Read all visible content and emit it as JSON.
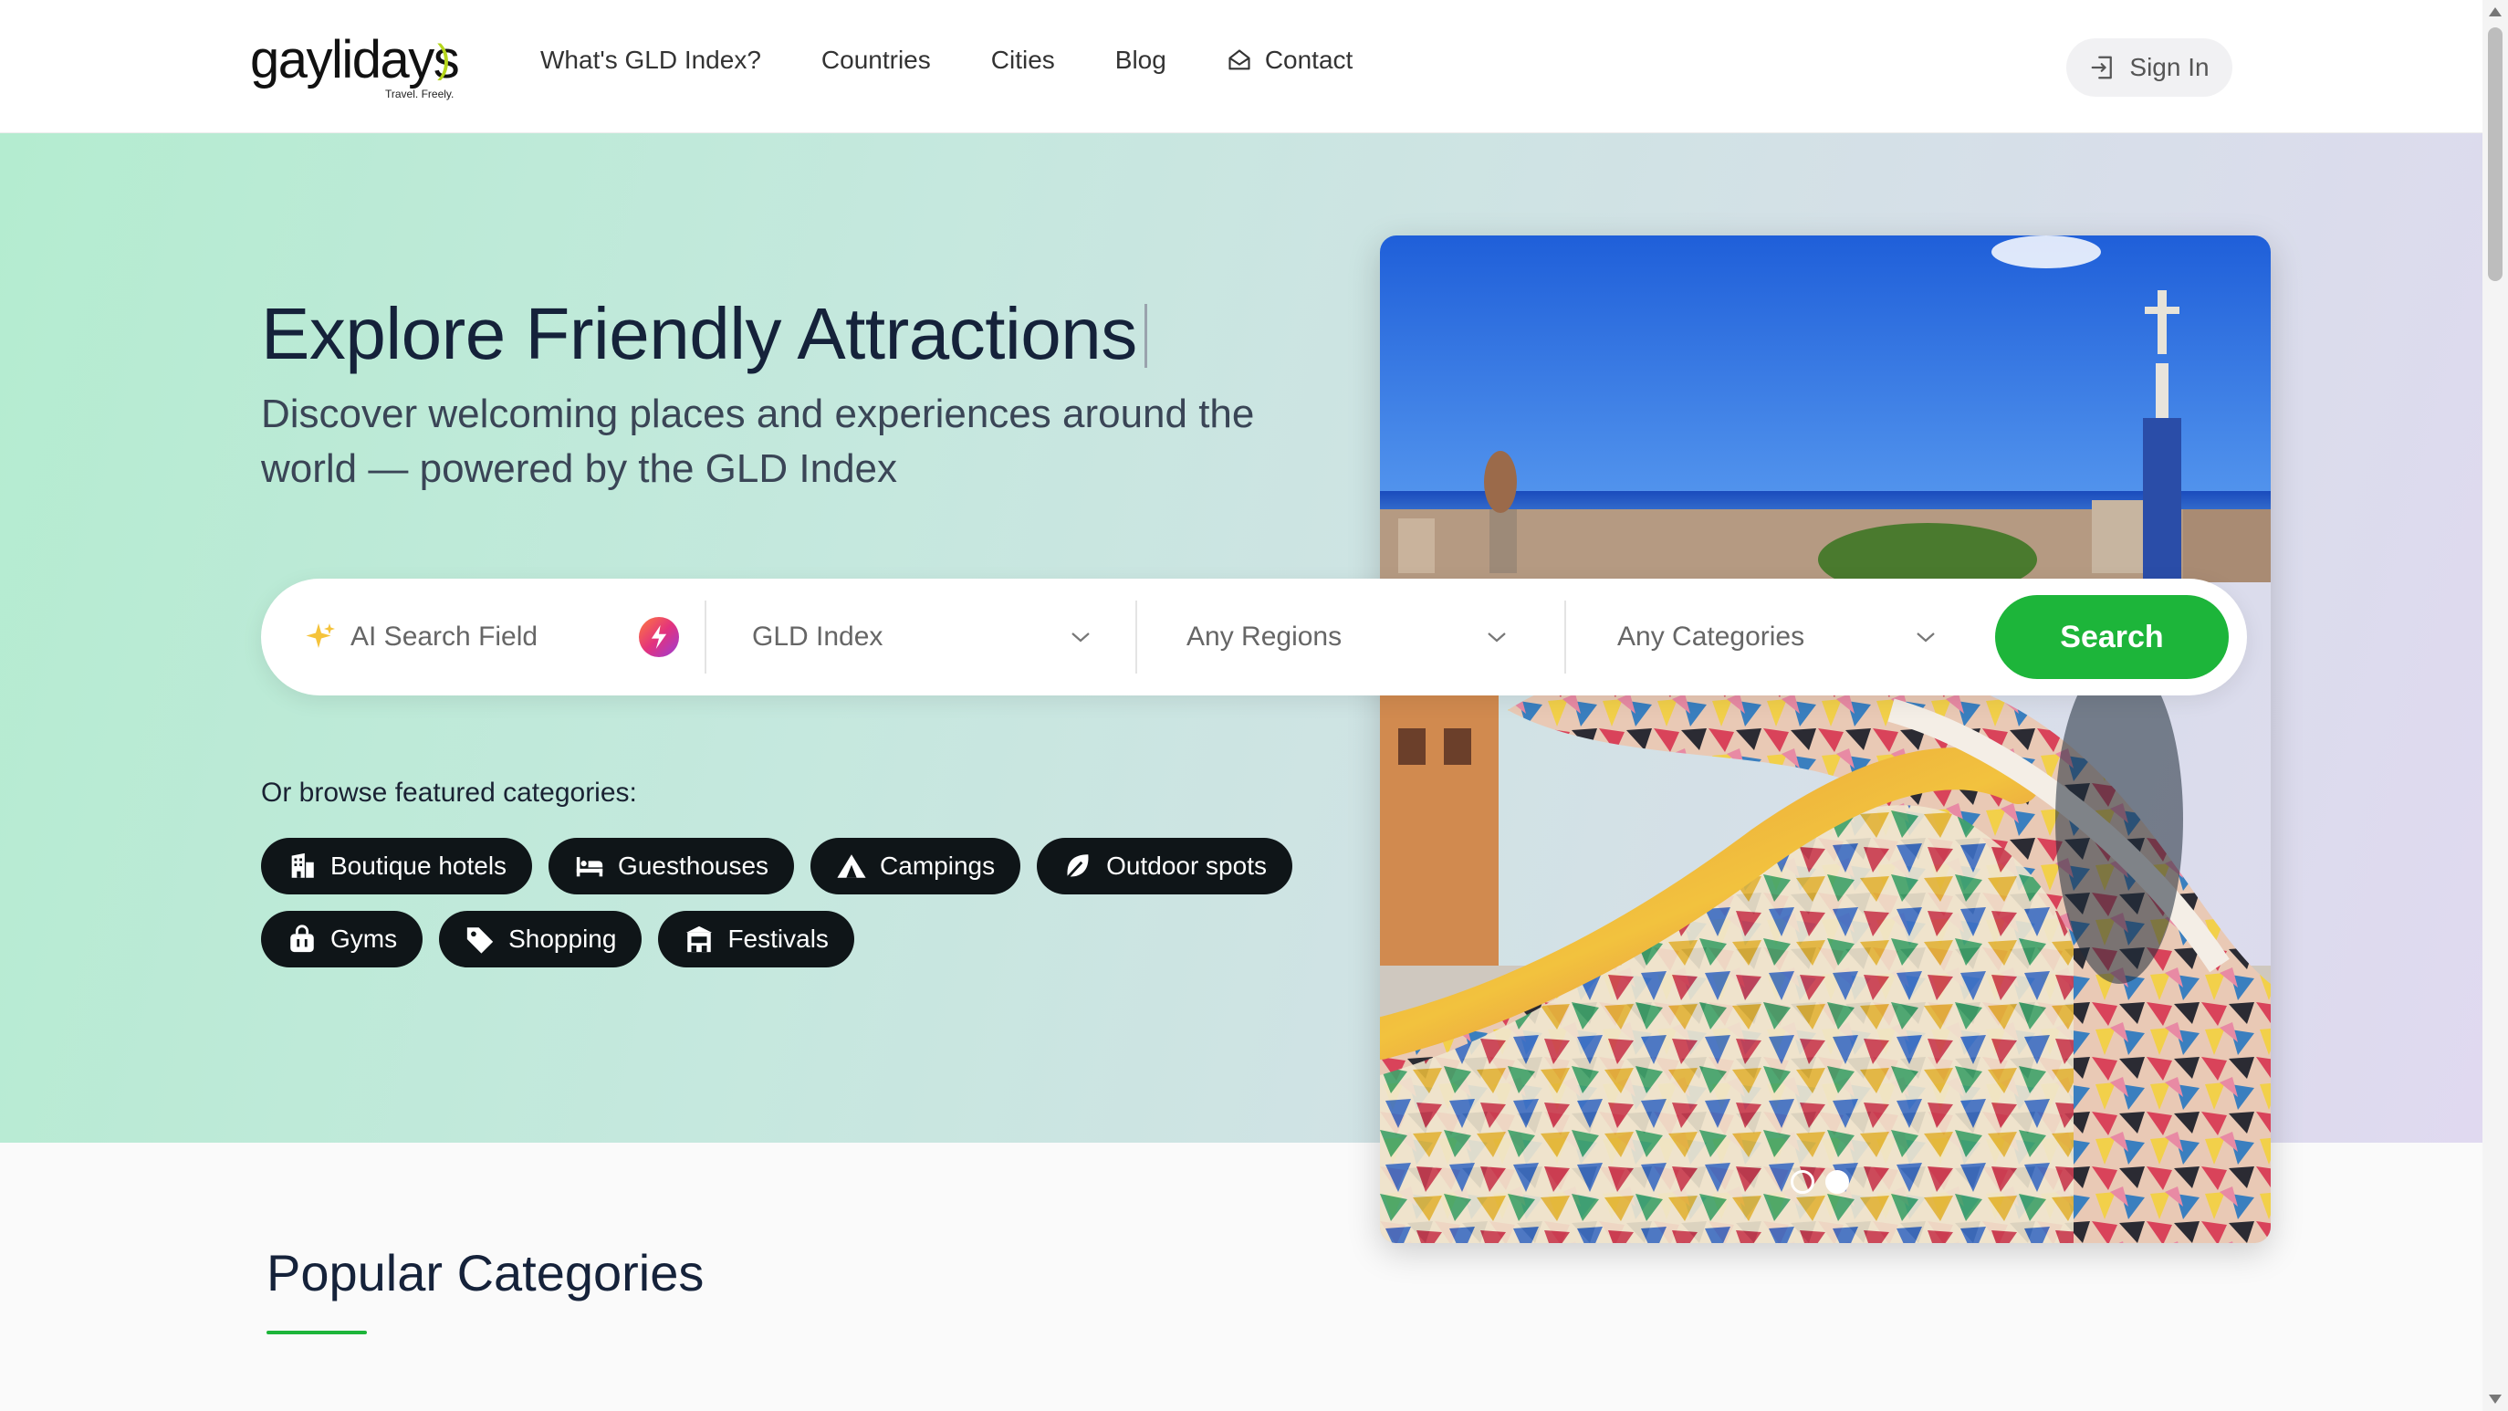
{
  "header": {
    "logo_text": "gaylidays",
    "logo_tagline": "Travel. Freely.",
    "nav": [
      {
        "label": "What's GLD Index?",
        "icon": ""
      },
      {
        "label": "Countries",
        "icon": ""
      },
      {
        "label": "Cities",
        "icon": ""
      },
      {
        "label": "Blog",
        "icon": ""
      },
      {
        "label": "Contact",
        "icon": "mail-open-icon"
      }
    ],
    "signin_label": "Sign In",
    "signin_icon": "sign-in-icon"
  },
  "hero": {
    "title": "Explore Friendly Attractions",
    "subtitle": "Discover welcoming places and experiences around the world — powered by the GLD Index"
  },
  "search": {
    "ai_placeholder": "AI Search Field",
    "ai_icon": "sparkle-icon",
    "bolt_icon": "lightning-icon",
    "index_select": "GLD Index",
    "region_select": "Any Regions",
    "category_select": "Any Categories",
    "button_label": "Search",
    "button_color": "#1db53a"
  },
  "featured": {
    "label": "Or browse featured categories:",
    "chips": [
      {
        "label": "Boutique hotels",
        "icon": "hotel-building-icon"
      },
      {
        "label": "Guesthouses",
        "icon": "bed-icon"
      },
      {
        "label": "Campings",
        "icon": "tent-icon"
      },
      {
        "label": "Outdoor spots",
        "icon": "leaf-icon"
      },
      {
        "label": "Gyms",
        "icon": "gym-bag-icon"
      },
      {
        "label": "Shopping",
        "icon": "price-tag-icon"
      },
      {
        "label": "Festivals",
        "icon": "ticket-booth-icon"
      }
    ]
  },
  "carousel": {
    "slide_count": 2,
    "active_index": 1
  },
  "popular": {
    "title": "Popular Categories"
  }
}
